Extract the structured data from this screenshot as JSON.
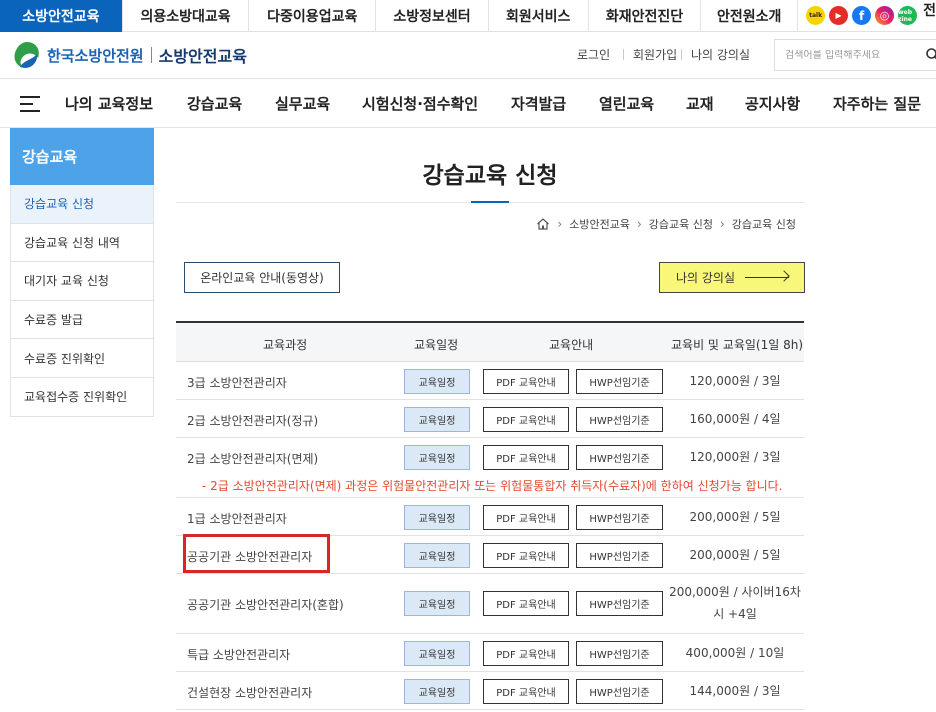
{
  "topbar": {
    "tabs": [
      "소방안전교육",
      "의용소방대교육",
      "다중이용업교육",
      "소방정보센터",
      "회원서비스",
      "화재안전진단",
      "안전원소개"
    ],
    "active_index": 0,
    "cut_label": "전",
    "socials": [
      {
        "name": "kakao-icon",
        "glyph": "talk"
      },
      {
        "name": "youtube-icon",
        "glyph": "▶"
      },
      {
        "name": "facebook-icon",
        "glyph": "f"
      },
      {
        "name": "instagram-icon",
        "glyph": "◎"
      },
      {
        "name": "webzine-icon",
        "glyph": "web zine"
      }
    ]
  },
  "header": {
    "org_name": "한국소방안전원",
    "service_name": "소방안전교육",
    "util": {
      "login": "로그인",
      "join": "회원가입",
      "my_lecture": "나의 강의실"
    },
    "search_placeholder": "검색어를 입력해주세요"
  },
  "nav": {
    "items": [
      "나의 교육정보",
      "강습교육",
      "실무교육",
      "시험신청·점수확인",
      "자격발급",
      "열린교육",
      "교재",
      "공지사항",
      "자주하는 질문"
    ]
  },
  "sidebar": {
    "title": "강습교육",
    "items": [
      "강습교육 신청",
      "강습교육 신청 내역",
      "대기자 교육 신청",
      "수료증 발급",
      "수료증 진위확인",
      "교육접수증 진위확인"
    ],
    "active_index": 0
  },
  "content": {
    "title": "강습교육 신청",
    "breadcrumb": [
      "소방안전교육",
      "강습교육 신청",
      "강습교육 신청"
    ],
    "online_btn": "온라인교육 안내(동영상)",
    "mylect_btn": "나의 강의실",
    "table": {
      "headers": [
        "교육과정",
        "교육일정",
        "교육안내",
        "교육비 및 교육일(1일 8h)"
      ],
      "schedule_label": "교육일정",
      "pdf_label": "PDF 교육안내",
      "hwp_label": "HWP선임기준",
      "rows": [
        {
          "name": "3급 소방안전관리자",
          "fee": "120,000원 / 3일"
        },
        {
          "name": "2급 소방안전관리자(정규)",
          "fee": "160,000원 / 4일"
        },
        {
          "name": "2급 소방안전관리자(면제)",
          "fee": "120,000원 / 3일"
        },
        {
          "name": "1급 소방안전관리자",
          "fee": "200,000원 / 5일"
        },
        {
          "name": "공공기관 소방안전관리자",
          "fee": "200,000원 / 5일"
        },
        {
          "name": "공공기관 소방안전관리자(혼합)",
          "fee": "200,000원 / 사이버16차시 +4일"
        },
        {
          "name": "특급 소방안전관리자",
          "fee": "400,000원 / 10일"
        },
        {
          "name": "건설현장 소방안전관리자",
          "fee": "144,000원 / 3일"
        }
      ],
      "notice": "- 2급 소방안전관리자(면제) 과정은 위험물안전관리자 또는 위험물통합자 취득자(수료자)에 한하여 신청가능 합니다."
    }
  }
}
